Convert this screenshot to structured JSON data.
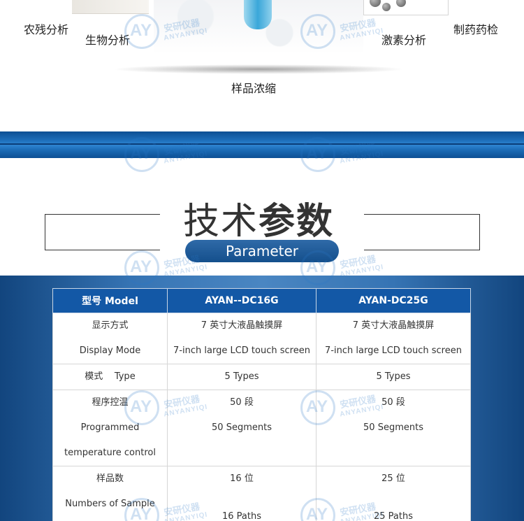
{
  "applications": {
    "pesticide": "农残分析",
    "biological": "生物分析",
    "hormone": "激素分析",
    "pharma": "制药药检",
    "concentration": "样品浓缩"
  },
  "heading": {
    "title_light": "技术",
    "title_bold": "参数",
    "subtitle": "Parameter"
  },
  "watermark": {
    "logo": "AY",
    "name_cn": "安研仪器",
    "name_en": "ANYANYIQI"
  },
  "table": {
    "headers": [
      "型号 Model",
      "AYAN--DC16G",
      "AYAN-DC25G"
    ],
    "rows": [
      {
        "label": [
          "显示方式",
          "Display Mode"
        ],
        "col1": [
          "7 英寸大液晶触摸屏",
          "7-inch large LCD touch screen"
        ],
        "col2": [
          "7 英寸大液晶触摸屏",
          "7-inch large LCD touch screen"
        ]
      },
      {
        "label": [
          "模式    Type"
        ],
        "col1": [
          "5 Types"
        ],
        "col2": [
          "5 Types"
        ]
      },
      {
        "label": [
          "程序控温",
          "Programmed",
          "temperature control"
        ],
        "col1": [
          "50 段",
          "",
          "50 Segments"
        ],
        "col2": [
          "50 段",
          "",
          "50 Segments"
        ]
      },
      {
        "label": [
          "样品数",
          "Numbers of Sample"
        ],
        "col1": [
          "16 位",
          "",
          "16 Paths"
        ],
        "col2": [
          "25 位",
          "",
          "25 Paths"
        ]
      }
    ]
  }
}
